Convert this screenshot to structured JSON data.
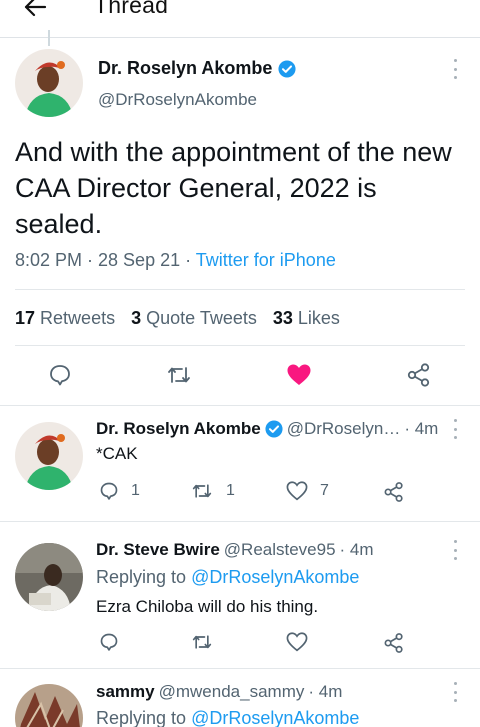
{
  "header": {
    "title": "Thread"
  },
  "main_tweet": {
    "name": "Dr. Roselyn Akombe",
    "handle": "@DrRoselynAkombe",
    "text": "And with the appointment of the new CAA Director General, 2022 is sealed.",
    "time": "8:02 PM · 28 Sep 21 · ",
    "source": "Twitter for iPhone",
    "stats": {
      "retweets_count": "17",
      "retweets_label": "Retweets",
      "quotes_count": "3",
      "quotes_label": "Quote Tweets",
      "likes_count": "33",
      "likes_label": "Likes"
    }
  },
  "replies": [
    {
      "name": "Dr. Roselyn Akombe",
      "handle": "@DrRoselyn…",
      "time": "· 4m",
      "text": "*CAK",
      "reply_count": "1",
      "retweet_count": "1",
      "like_count": "7"
    },
    {
      "name": "Dr. Steve Bwire",
      "handle": "@Realsteve95",
      "time": "· 4m",
      "replying_label": "Replying to",
      "replying_to": "@DrRoselynAkombe",
      "text": "Ezra Chiloba will do his thing."
    },
    {
      "name": "sammy",
      "handle": "@mwenda_sammy",
      "time": "· 4m",
      "replying_label": "Replying to",
      "replying_to": "@DrRoselynAkombe"
    }
  ],
  "colors": {
    "accent": "#1d9bf0",
    "like": "#f91880",
    "secondary": "#536471"
  }
}
